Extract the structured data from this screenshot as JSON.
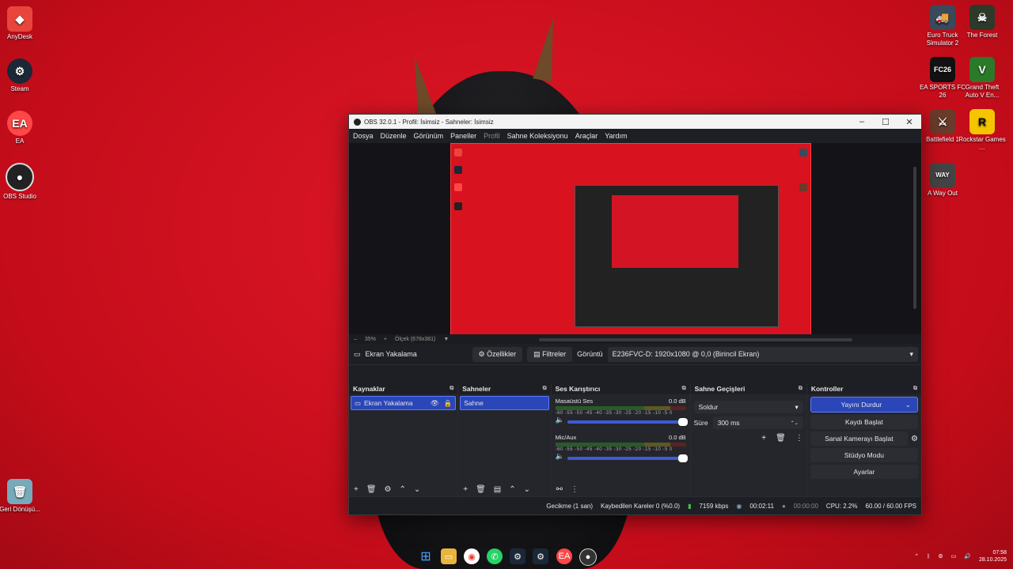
{
  "desktop": {
    "left_icons": [
      {
        "label": "AnyDesk",
        "icon": "anydesk-icon",
        "color": "#e8463c"
      },
      {
        "label": "Steam",
        "icon": "steam-icon",
        "color": "#1b2838"
      },
      {
        "label": "EA",
        "icon": "ea-icon",
        "color": "#ff4747"
      },
      {
        "label": "OBS Studio",
        "icon": "obs-icon",
        "color": "#222"
      },
      {
        "label": "Geri Dönüşü...",
        "icon": "recycle-bin-icon",
        "color": "#7ab"
      }
    ],
    "right_icons": [
      {
        "label": "Euro Truck Simulator 2",
        "icon": "ets2-icon",
        "color": "#3a4a5a"
      },
      {
        "label": "The Forest",
        "icon": "the-forest-icon",
        "color": "#2d3a2a"
      },
      {
        "label": "EA SPORTS FC 26",
        "icon": "fc26-icon",
        "color": "#111"
      },
      {
        "label": "Grand Theft Auto V En...",
        "icon": "gta-icon",
        "color": "#2a7a2a"
      },
      {
        "label": "Battlefield 1",
        "icon": "battlefield-icon",
        "color": "#6a3a2a"
      },
      {
        "label": "Rockstar Games ...",
        "icon": "rockstar-icon",
        "color": "#f4c500"
      },
      {
        "label": "A Way Out",
        "icon": "a-way-out-icon",
        "color": "#444"
      }
    ]
  },
  "obs": {
    "title": "OBS 32.0.1 - Profil: İsimsiz - Sahneler: İsimsiz",
    "menu": [
      "Dosya",
      "Düzenle",
      "Görünüm",
      "Paneller",
      "Profil",
      "Sahne Koleksiyonu",
      "Araçlar",
      "Yardım"
    ],
    "zoom": {
      "percent": "35%",
      "scale_label": "Ölçek (678x381)"
    },
    "source_bar": {
      "selected_source": "Ekran Yakalama",
      "properties": "Özellikler",
      "filters": "Filtreler",
      "display_label": "Görüntü",
      "display_value": "E236FVC-D: 1920x1080 @ 0,0 (Birincil Ekran)"
    },
    "sources": {
      "title": "Kaynaklar",
      "items": [
        "Ekran Yakalama"
      ]
    },
    "scenes": {
      "title": "Sahneler",
      "items": [
        "Sahne"
      ]
    },
    "mixer": {
      "title": "Ses Karıştırıcı",
      "channels": [
        {
          "name": "Masaüstü Ses",
          "db": "0.0 dB"
        },
        {
          "name": "Mic/Aux",
          "db": "0.0 dB"
        }
      ],
      "scale": "-60 -55 -50 -45 -40 -35 -30 -25 -20 -15 -10 -5 0"
    },
    "transitions": {
      "title": "Sahne Geçişleri",
      "type": "Soldur",
      "duration_label": "Süre",
      "duration_value": "300 ms"
    },
    "controls": {
      "title": "Kontroller",
      "stop_stream": "Yayını Durdur",
      "start_record": "Kaydı Başlat",
      "virtual_camera": "Sanal Kamerayı Başlat",
      "studio_mode": "Stüdyo Modu",
      "settings": "Ayarlar"
    },
    "status": {
      "delay": "Gecikme (1 san)",
      "dropped": "Kaybedilen Kareler 0 (%0.0)",
      "bitrate": "7159 kbps",
      "stream_time": "00:02:11",
      "record_time": "00:00:00",
      "cpu": "CPU: 2.2%",
      "fps": "60.00 / 60.00 FPS"
    }
  },
  "taskbar": {
    "clock_time": "07:58",
    "clock_date": "28.10.2025"
  }
}
